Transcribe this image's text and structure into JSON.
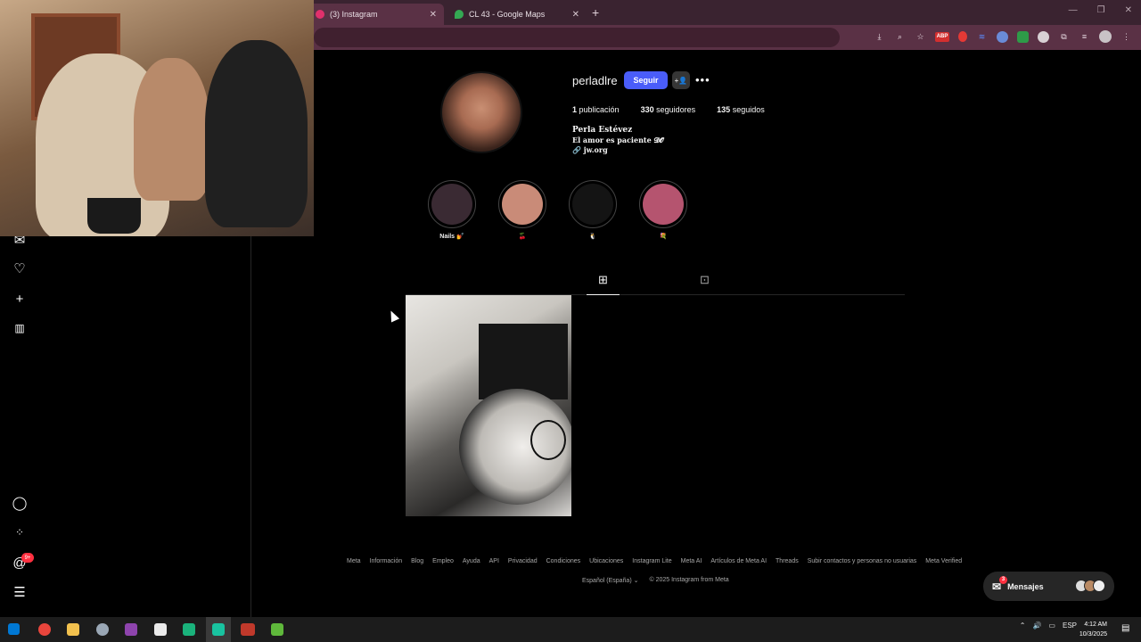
{
  "browser": {
    "tabs": [
      {
        "title": "(3) Instagram",
        "favicon": "instagram-icon",
        "active": true
      },
      {
        "title": "CL 43 - Google Maps",
        "favicon": "maps-pin-icon",
        "active": false
      }
    ],
    "toolbar_icons": [
      "install-icon",
      "zoom-icon",
      "star-icon",
      "adblock-icon",
      "extension-icon",
      "extension-icon",
      "extension-icon",
      "extension-icon",
      "extension-icon",
      "puzzle-icon",
      "media-icon",
      "profile-icon",
      "menu-icon"
    ],
    "adblock_label": "ABP"
  },
  "profile": {
    "username": "perladlre",
    "follow_label": "Seguir",
    "posts_count": "1",
    "posts_label": "publicación",
    "followers_count": "330",
    "followers_label": "seguidores",
    "following_count": "135",
    "following_label": "seguidos",
    "full_name": "Perla Estévez",
    "bio": "El amor es paciente 𝓓𝓞",
    "link": "jw.org"
  },
  "highlights": [
    {
      "label": "Nails 💅",
      "color": "#3a2a33"
    },
    {
      "label": "🍒",
      "color": "#c98b78"
    },
    {
      "label": "🐧",
      "color": "#141414"
    },
    {
      "label": "💐",
      "color": "#b5546f"
    }
  ],
  "nav": {
    "badge_threads": "9+",
    "icons": [
      "messenger-icon",
      "heart-icon",
      "plus-icon",
      "insights-icon",
      "threads-icon",
      "apps-icon",
      "threads-badge-icon",
      "menu-icon"
    ]
  },
  "footer": {
    "links": [
      "Meta",
      "Información",
      "Blog",
      "Empleo",
      "Ayuda",
      "API",
      "Privacidad",
      "Condiciones",
      "Ubicaciones",
      "Instagram Lite",
      "Meta AI",
      "Artículos de Meta AI",
      "Threads",
      "Subir contactos y personas no usuarias",
      "Meta Verified"
    ],
    "language": "Español (España)",
    "copyright": "© 2025 Instagram from Meta"
  },
  "messages": {
    "label": "Mensajes",
    "badge": "3"
  },
  "taskbar": {
    "language": "ESP",
    "time": "4:12 AM",
    "date": "10/3/2025",
    "notif_count": "3"
  },
  "colors": {
    "follow": "#4a5df9",
    "tabbar": "#3a2330",
    "toolbar": "#5a3145"
  }
}
